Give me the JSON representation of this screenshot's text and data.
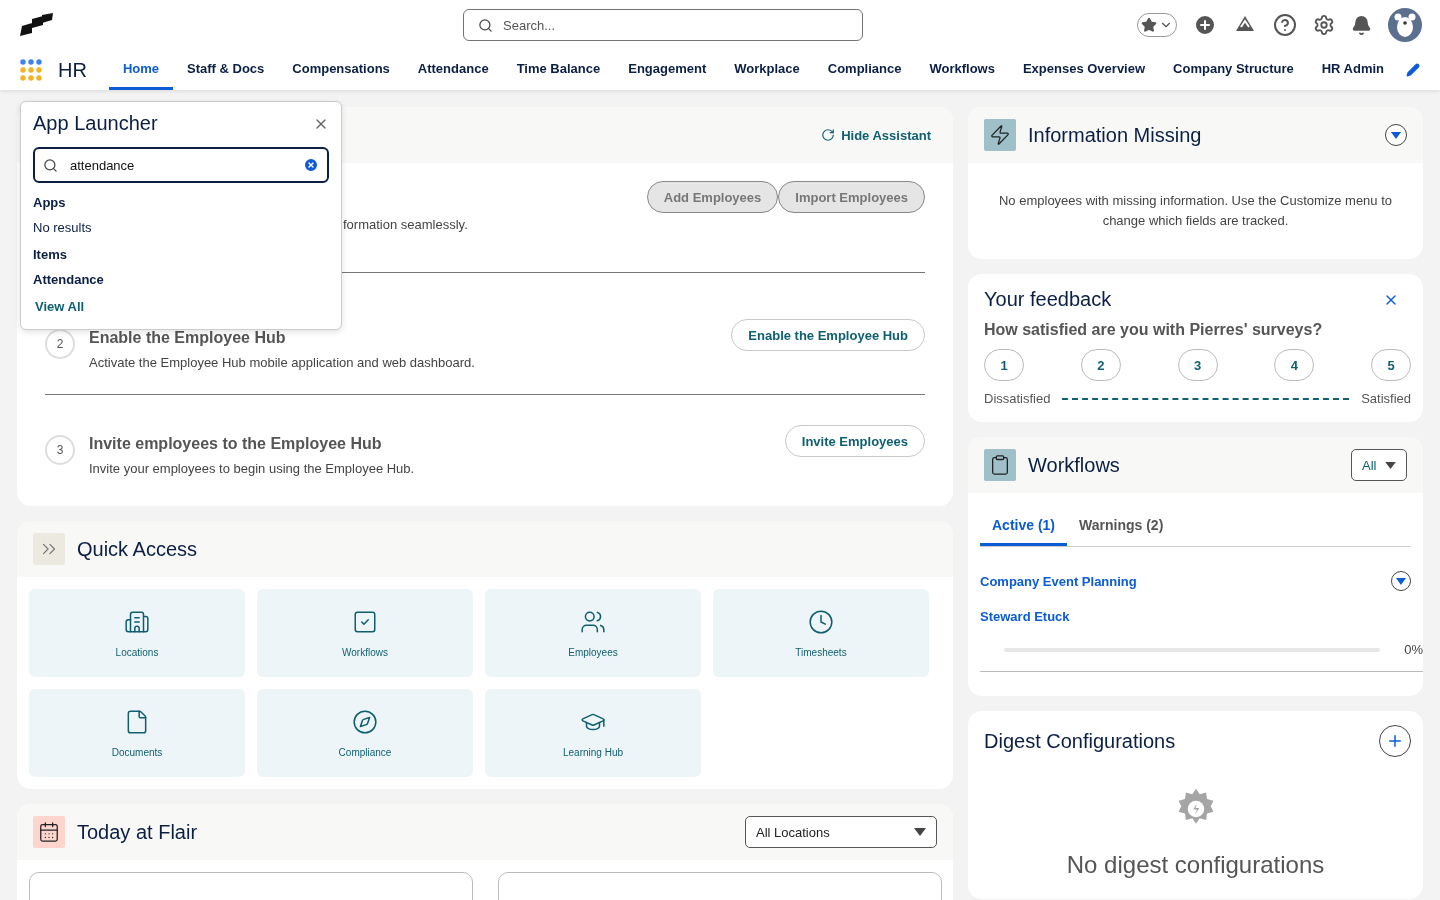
{
  "top_bar": {
    "search": {
      "placeholder": "Search..."
    }
  },
  "nav": {
    "app_name": "HR",
    "tabs": [
      {
        "label": "Home",
        "selected": true
      },
      {
        "label": "Staff & Docs",
        "selected": false
      },
      {
        "label": "Compensations",
        "selected": false
      },
      {
        "label": "Attendance",
        "selected": false
      },
      {
        "label": "Time Balance",
        "selected": false
      },
      {
        "label": "Engagement",
        "selected": false
      },
      {
        "label": "Workplace",
        "selected": false
      },
      {
        "label": "Compliance",
        "selected": false
      },
      {
        "label": "Workflows",
        "selected": false
      },
      {
        "label": "Expenses Overview",
        "selected": false
      },
      {
        "label": "Company Structure",
        "selected": false
      },
      {
        "label": "HR Admin",
        "selected": false
      }
    ]
  },
  "app_launcher": {
    "title": "App Launcher",
    "search": {
      "value": "attendance"
    },
    "sections": [
      {
        "heading": "Apps",
        "items": [
          {
            "label": "No results",
            "kind": "empty"
          }
        ]
      },
      {
        "heading": "Items",
        "items": [
          {
            "label": "Attendance",
            "kind": "item"
          }
        ]
      }
    ],
    "view_all": "View All"
  },
  "assistant": {
    "hide_label": "Hide Assistant",
    "steps": [
      {
        "description": "formation seamlessly.",
        "buttons": [
          {
            "label": "Add Employees",
            "disabled": true
          },
          {
            "label": "Import Employees",
            "disabled": true
          }
        ]
      },
      {
        "number": "2",
        "title": "Enable the Employee Hub",
        "description": "Activate the Employee Hub mobile application and web dashboard.",
        "buttons": [
          {
            "label": "Enable the Employee Hub",
            "disabled": false
          }
        ]
      },
      {
        "number": "3",
        "title": "Invite employees to the Employee Hub",
        "description": "Invite your employees to begin using the Employee Hub.",
        "buttons": [
          {
            "label": "Invite Employees",
            "disabled": false
          }
        ]
      }
    ]
  },
  "quick_access": {
    "title": "Quick Access",
    "items": [
      {
        "label": "Locations"
      },
      {
        "label": "Workflows"
      },
      {
        "label": "Employees"
      },
      {
        "label": "Timesheets"
      },
      {
        "label": "Documents"
      },
      {
        "label": "Compliance"
      },
      {
        "label": "Learning Hub"
      }
    ]
  },
  "today": {
    "title": "Today at Flair",
    "location_select": "All Locations"
  },
  "information_missing": {
    "title": "Information Missing",
    "message": "No employees with missing information. Use the Customize menu to change which fields are tracked."
  },
  "feedback": {
    "title": "Your feedback",
    "question": "How satisfied are you with Pierres' surveys?",
    "scale": [
      "1",
      "2",
      "3",
      "4",
      "5"
    ],
    "low_label": "Dissatisfied",
    "high_label": "Satisfied"
  },
  "workflows": {
    "title": "Workflows",
    "filter": "All",
    "tabs": [
      {
        "label": "Active (1)",
        "selected": true
      },
      {
        "label": "Warnings (2)",
        "selected": false
      }
    ],
    "items": [
      {
        "title": "Company Event Planning",
        "assignee": "Steward Etuck",
        "level": 0,
        "reading": "0%"
      }
    ]
  },
  "digest": {
    "title": "Digest Configurations",
    "empty_message": "No digest configurations"
  }
}
